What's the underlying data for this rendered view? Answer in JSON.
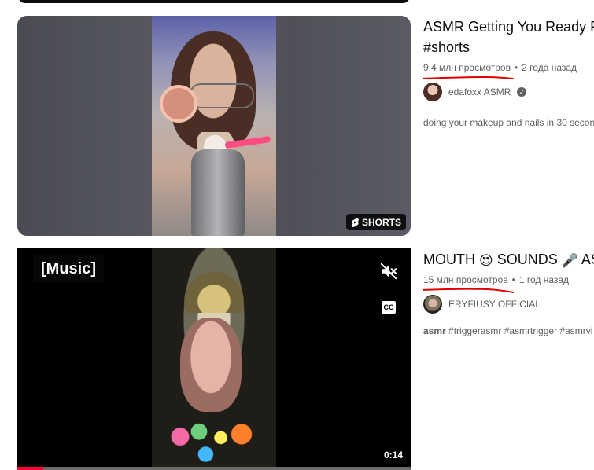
{
  "videos": [
    {
      "title": "ASMR Getting You Ready Fo",
      "title_line2": "#shorts",
      "views": "9,4 млн просмотров",
      "age": "2 года назад",
      "channel": "edafoxx ASMR",
      "verified": true,
      "description": "doing your makeup and nails in 30 secon",
      "badge": "SHORTS"
    },
    {
      "title_parts": [
        "MOUTH ",
        "😍",
        " SOUNDS ",
        "🎤",
        " AS"
      ],
      "views": "15 млн просмотров",
      "age": "1 год назад",
      "channel": "ERYFIUSY OFFICIAL",
      "description_bold": "asmr",
      "description_rest": " #triggerasmr #asmrtrigger #asmrvi",
      "caption": "[Music]",
      "cc_label": "CC",
      "time": "0:14",
      "progress": 0.065
    }
  ],
  "colors": {
    "accent_red": "#ff0033",
    "underline_red": "#e00000"
  },
  "icons": {
    "shorts": "shorts-icon",
    "mute": "mute-icon",
    "captions": "closed-captions-icon",
    "verified": "verified-check-icon"
  }
}
